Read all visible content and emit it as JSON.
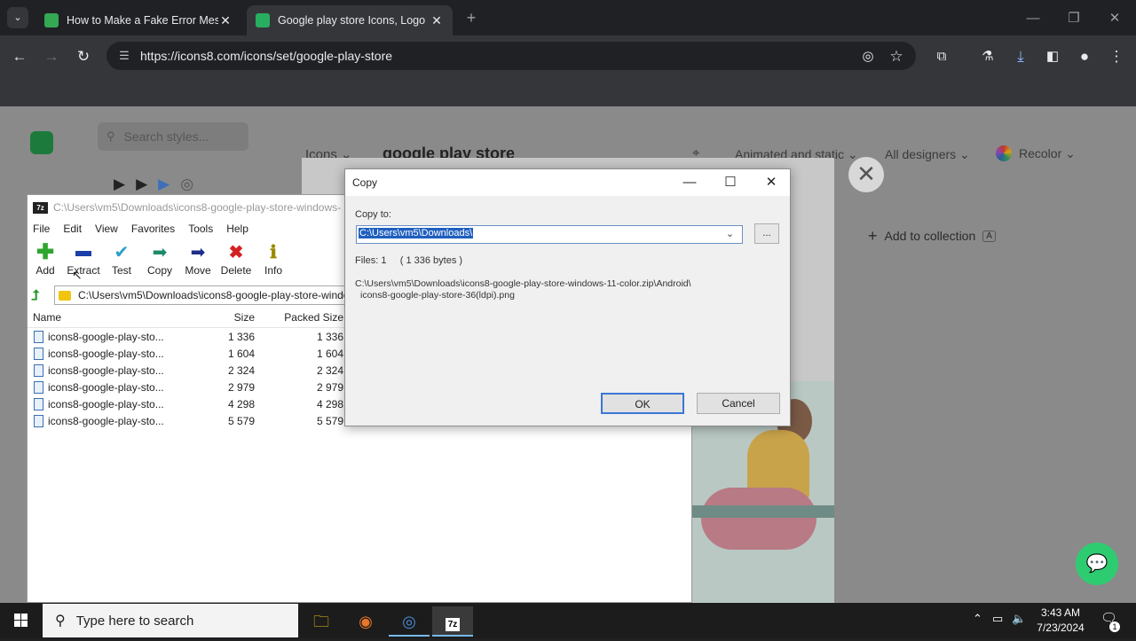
{
  "browser": {
    "tabs": [
      {
        "title": "How to Make a Fake Error Mes",
        "active": false,
        "favicon_color": "#34a853"
      },
      {
        "title": "Google play store Icons, Logo",
        "active": true,
        "favicon_color": "#27ae60"
      }
    ],
    "new_tab": "+",
    "url": "https://icons8.com/icons/set/google-play-store"
  },
  "page": {
    "search_placeholder": "Search styles...",
    "heading": "google play store",
    "icons_dropdown": "Icons",
    "filter_animated": "Animated and static",
    "filter_designers": "All designers",
    "recolor": "Recolor",
    "add_to_collection": "Add to collection",
    "shortcut_key": "A",
    "close_symbol": "✕"
  },
  "zip": {
    "logo": "7z",
    "title": "C:\\Users\\vm5\\Downloads\\icons8-google-play-store-windows-",
    "menu": [
      "File",
      "Edit",
      "View",
      "Favorites",
      "Tools",
      "Help"
    ],
    "tools": [
      {
        "label": "Add",
        "icon": "plus-icon",
        "color": "#2ea52e"
      },
      {
        "label": "Extract",
        "icon": "minus-icon",
        "color": "#1c3ea8"
      },
      {
        "label": "Test",
        "icon": "check-icon",
        "color": "#2aa0c8"
      },
      {
        "label": "Copy",
        "icon": "arrow-right-icon",
        "color": "#1d8a6a"
      },
      {
        "label": "Move",
        "icon": "arrow-right-icon",
        "color": "#1c2e8a"
      },
      {
        "label": "Delete",
        "icon": "x-icon",
        "color": "#d42020"
      },
      {
        "label": "Info",
        "icon": "info-icon",
        "color": "#c8b400"
      }
    ],
    "path": "C:\\Users\\vm5\\Downloads\\icons8-google-play-store-windo",
    "columns": {
      "name": "Name",
      "size": "Size",
      "packed": "Packed Size"
    },
    "files": [
      {
        "name": "icons8-google-play-sto...",
        "size": "1 336",
        "packed": "1 336"
      },
      {
        "name": "icons8-google-play-sto...",
        "size": "1 604",
        "packed": "1 604"
      },
      {
        "name": "icons8-google-play-sto...",
        "size": "2 324",
        "packed": "2 324"
      },
      {
        "name": "icons8-google-play-sto...",
        "size": "2 979",
        "packed": "2 979"
      },
      {
        "name": "icons8-google-play-sto...",
        "size": "4 298",
        "packed": "4 298"
      },
      {
        "name": "icons8-google-play-sto...",
        "size": "5 579",
        "packed": "5 579"
      }
    ]
  },
  "copy_dialog": {
    "title": "Copy",
    "copy_to_label": "Copy to:",
    "copy_to_value": "C:\\Users\\vm5\\Downloads\\",
    "browse": "...",
    "files_info": "Files: 1     ( 1 336 bytes )",
    "source_line1": "C:\\Users\\vm5\\Downloads\\icons8-google-play-store-windows-11-color.zip\\Android\\",
    "source_line2": "icons8-google-play-store-36(ldpi).png",
    "ok": "OK",
    "cancel": "Cancel"
  },
  "taskbar": {
    "search_placeholder": "Type here to search",
    "time": "3:43 AM",
    "date": "7/23/2024",
    "notification_count": "1"
  }
}
